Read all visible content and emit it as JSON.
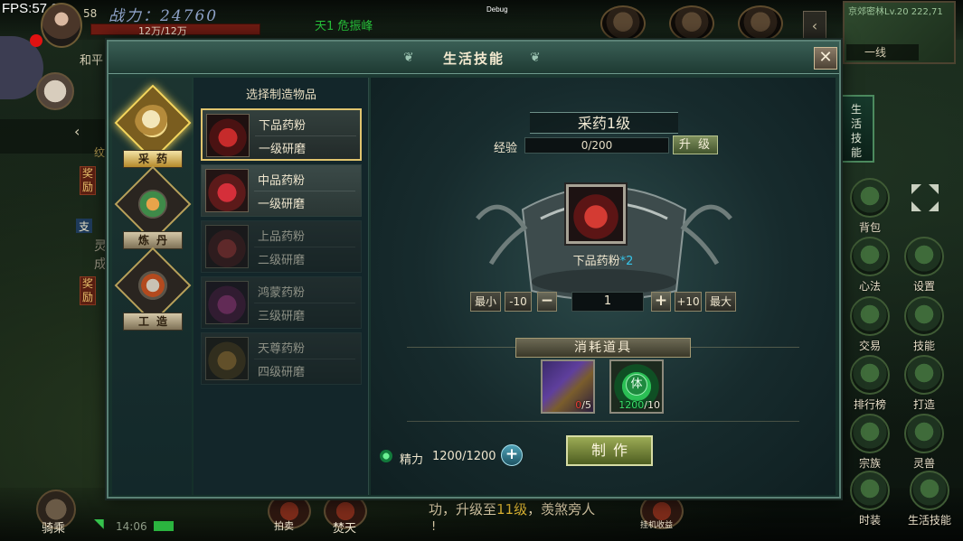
{
  "hud": {
    "fps": "FPS:57.03",
    "level": "58",
    "power_label": "战力：",
    "power_value": "24760",
    "hp_text": "12万/12万",
    "quest_top": "天1 危振峰",
    "debug": "Debug",
    "minimap_title": "京郊密林Lv.20  222,71",
    "minimap_line": "一线",
    "peace_label": "和平",
    "side_tags": [
      "奖励",
      "奖励"
    ],
    "left_text": [
      "支",
      "灵",
      "成",
      "纹"
    ],
    "mount_label": "骑乘",
    "clock": "14:06",
    "bottom_message_prefix": "功，升级至",
    "bottom_message_level": "11级",
    "bottom_message_suffix": "，羡煞旁人",
    "bottom_mark": "!",
    "bottom_skills": [
      "拍卖",
      "焚天",
      "挂机收益"
    ]
  },
  "right_menu": {
    "life_tab": "生活技能",
    "buttons": [
      {
        "label": "背包",
        "icon": "backpack-icon"
      },
      {
        "label": "心法",
        "icon": "mind-method-icon"
      },
      {
        "label": "设置",
        "icon": "settings-icon"
      },
      {
        "label": "交易",
        "icon": "trade-icon"
      },
      {
        "label": "技能",
        "icon": "skill-icon"
      },
      {
        "label": "排行榜",
        "icon": "ranking-icon"
      },
      {
        "label": "打造",
        "icon": "forge-icon"
      },
      {
        "label": "宗族",
        "icon": "clan-icon"
      },
      {
        "label": "灵兽",
        "icon": "spirit-beast-icon"
      },
      {
        "label": "时装",
        "icon": "fashion-icon"
      },
      {
        "label": "生活技能",
        "icon": "life-skill-icon"
      }
    ]
  },
  "modal": {
    "title": "生活技能",
    "close": "✕",
    "categories": [
      {
        "label": "采药",
        "icon": "gourd-icon",
        "active": true
      },
      {
        "label": "炼丹",
        "icon": "alchemy-icon",
        "active": false
      },
      {
        "label": "工造",
        "icon": "hammer-icon",
        "active": false
      }
    ],
    "list_header": "选择制造物品",
    "items": [
      {
        "name": "下品药粉",
        "grade": "一级研磨",
        "state": "selected"
      },
      {
        "name": "中品药粉",
        "grade": "一级研磨",
        "state": "available"
      },
      {
        "name": "上品药粉",
        "grade": "二级研磨",
        "state": "locked"
      },
      {
        "name": "鸿蒙药粉",
        "grade": "三级研磨",
        "state": "locked"
      },
      {
        "name": "天尊药粉",
        "grade": "四级研磨",
        "state": "locked"
      }
    ],
    "detail": {
      "skill_title": "采药1级",
      "exp_label": "经验",
      "exp_text": "0/200",
      "exp_progress": 0,
      "upgrade": "升 级",
      "result_name": "下品药粉",
      "result_count": "*2",
      "qty_buttons": {
        "min": "最小",
        "minus10": "-10",
        "minus": "−",
        "plus": "+",
        "plus10": "+10",
        "max": "最大"
      },
      "quantity": "1",
      "consume_header": "消耗道具",
      "materials": [
        {
          "icon": "herb-material-icon",
          "have": "0",
          "need": "/5",
          "enough": false
        },
        {
          "icon": "stamina-material-icon",
          "glyph": "体",
          "have": "1200",
          "need": "/10",
          "enough": true
        }
      ],
      "energy_label": "精力",
      "energy_value": "1200/1200",
      "energy_plus": "+",
      "make": "制作"
    }
  }
}
